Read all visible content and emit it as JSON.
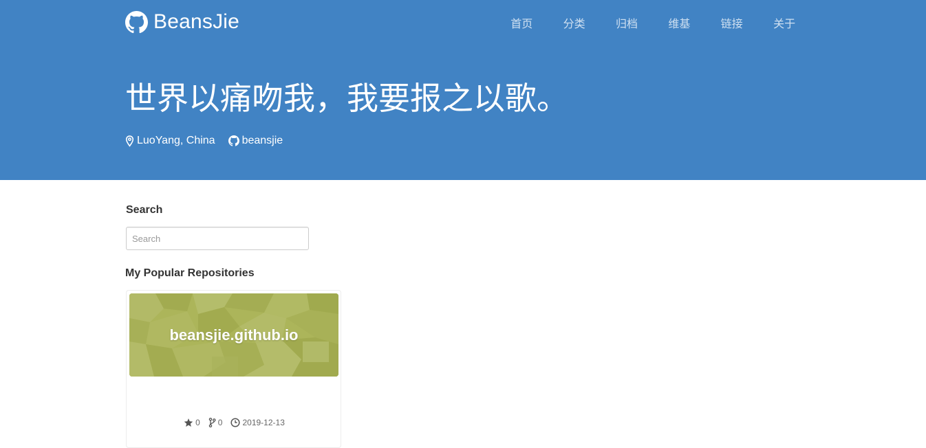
{
  "header": {
    "brand": "BeansJie",
    "nav": [
      "首页",
      "分类",
      "归档",
      "维基",
      "链接",
      "关于"
    ],
    "headline": "世界以痛吻我，我要报之以歌。",
    "location": "LuoYang, China",
    "github_user": "beansjie",
    "background_color": "#4183c4"
  },
  "sidebar": {
    "search_title": "Search",
    "search_placeholder": "Search",
    "repos_title": "My Popular Repositories"
  },
  "repo": {
    "name": "beansjie.github.io",
    "stars": "0",
    "forks": "0",
    "updated": "2019-12-13",
    "cover_color": "#acb55a"
  },
  "icons": {
    "brand": "github-icon",
    "location": "map-marker-icon",
    "github_link": "github-icon",
    "stars": "star-icon",
    "forks": "git-branch-icon",
    "updated": "clock-icon"
  }
}
